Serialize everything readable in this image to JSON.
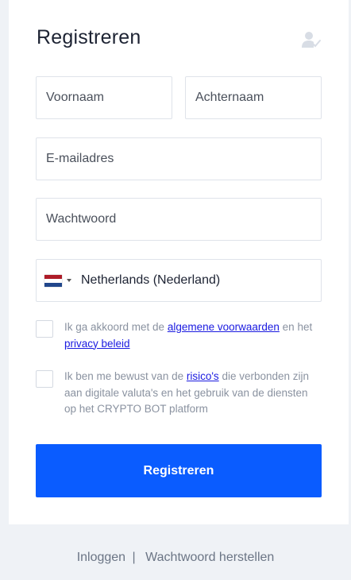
{
  "form": {
    "title": "Registreren",
    "first_name_placeholder": "Voornaam",
    "last_name_placeholder": "Achternaam",
    "email_placeholder": "E-mailadres",
    "password_placeholder": "Wachtwoord",
    "country": {
      "selected": "Netherlands (Nederland)",
      "flag_colors": [
        "#ae1c28",
        "#ffffff",
        "#21468b"
      ]
    },
    "terms": {
      "text_before": "Ik ga akkoord met de ",
      "link1": "algemene voorwaarden",
      "text_middle": " en het ",
      "link2": "privacy beleid"
    },
    "risk": {
      "text_before": "Ik ben me bewust van de ",
      "link": "risico's",
      "text_after": " die verbonden zijn aan digitale valuta's en het gebruik van de diensten op het CRYPTO BOT platform"
    },
    "submit_label": "Registreren"
  },
  "footer": {
    "login": "Inloggen",
    "separator": "|",
    "reset": "Wachtwoord herstellen"
  },
  "colors": {
    "accent": "#0a5cff",
    "link": "#1a1ae0"
  },
  "icons": {
    "header": "user-check-icon"
  }
}
